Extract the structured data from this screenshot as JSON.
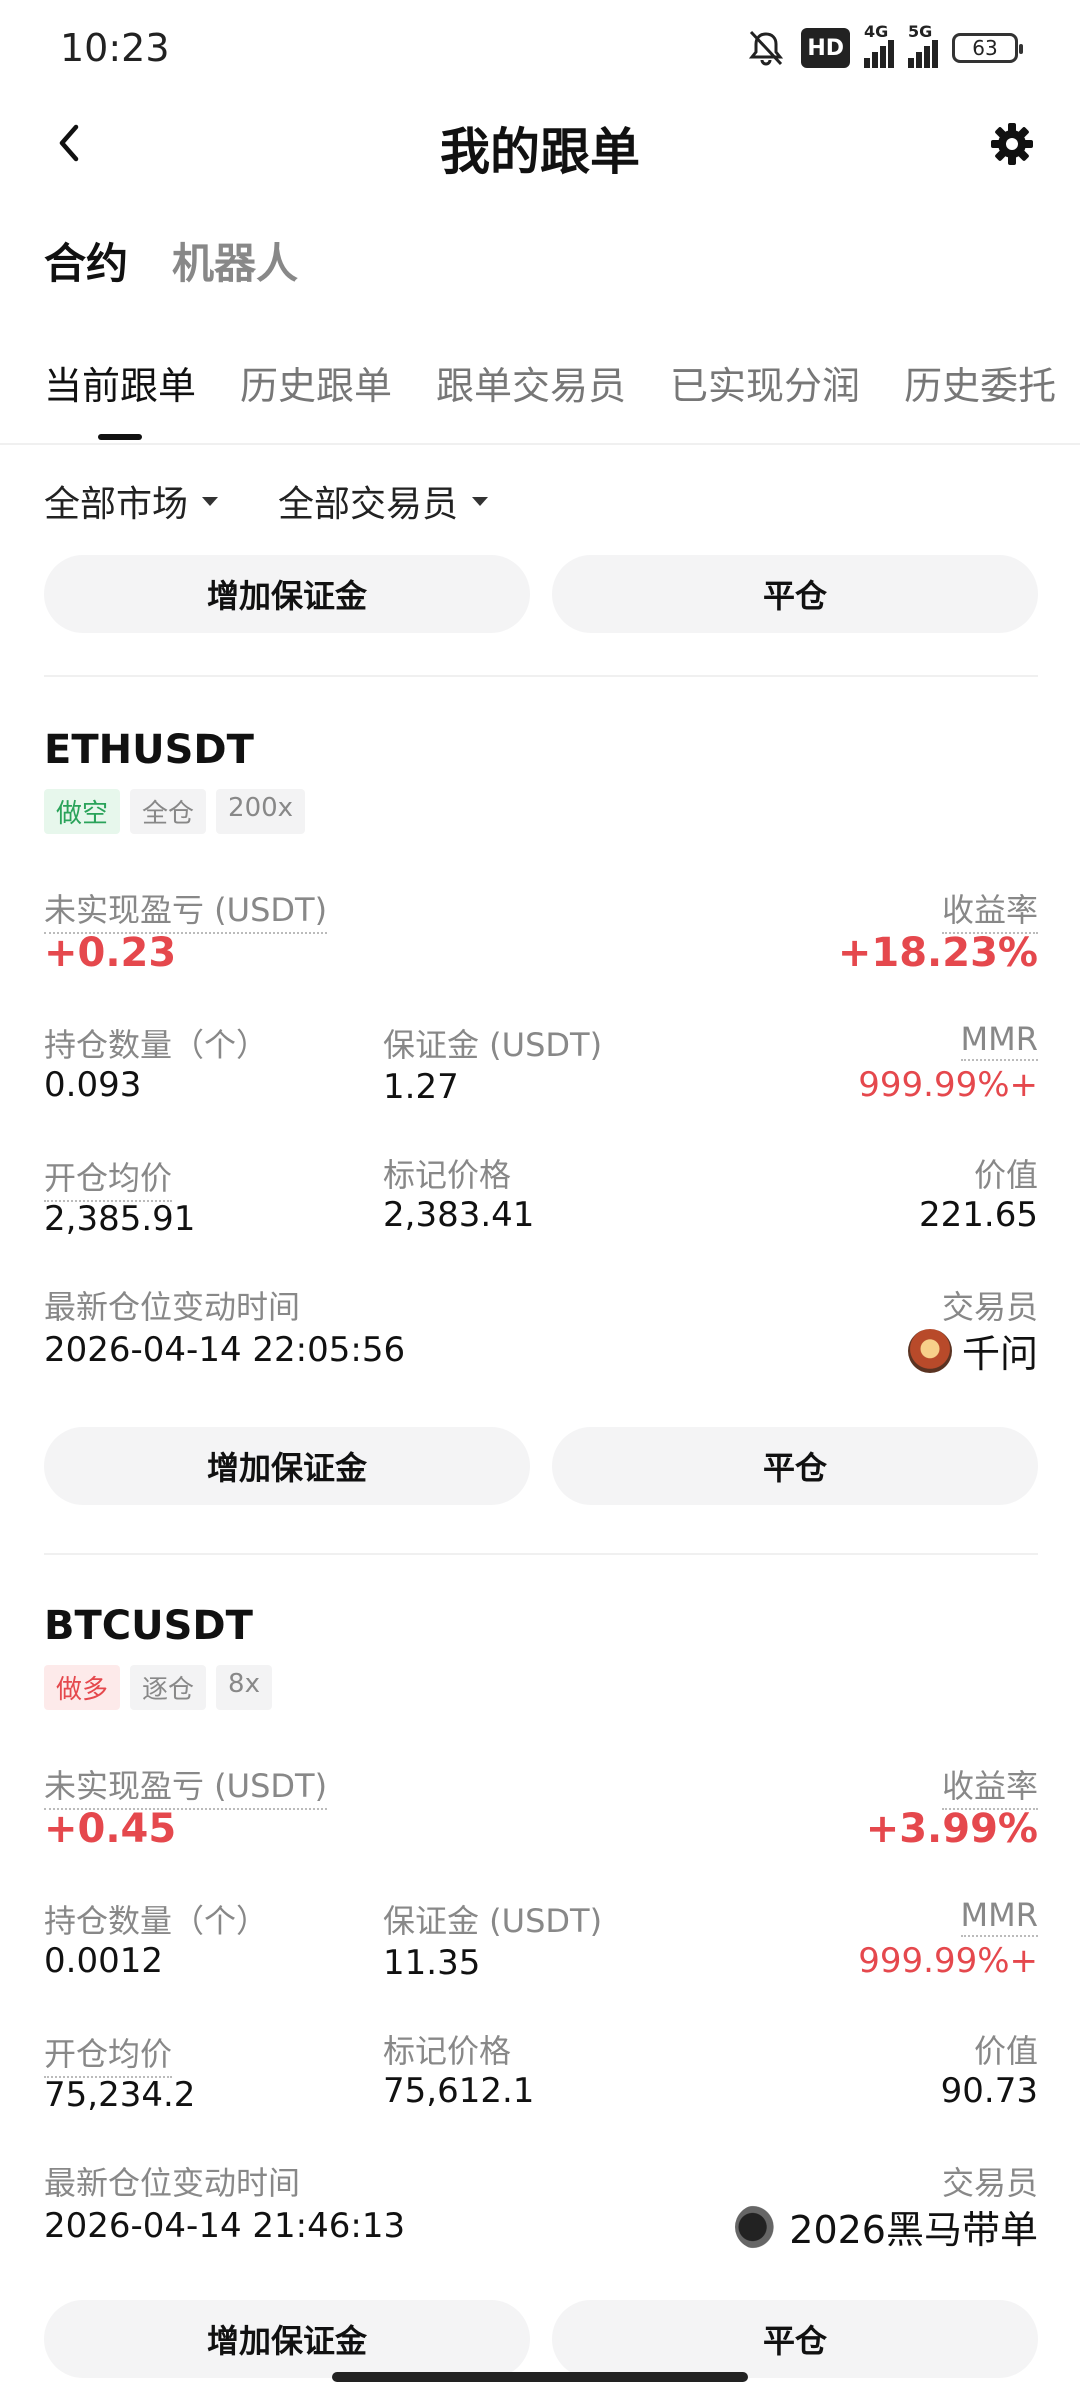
{
  "status_bar": {
    "time": "10:23",
    "hd": "HD",
    "net1": "4G",
    "net2": "5G",
    "battery": "63"
  },
  "header": {
    "title": "我的跟单"
  },
  "category_tabs": [
    "合约",
    "机器人"
  ],
  "sub_tabs": [
    "当前跟单",
    "历史跟单",
    "跟单交易员",
    "已实现分润",
    "历史委托"
  ],
  "filters": {
    "market": "全部市场",
    "trader": "全部交易员"
  },
  "buttons": {
    "add_margin": "增加保证金",
    "close": "平仓"
  },
  "labels": {
    "unrealized_pnl": "未实现盈亏 (USDT)",
    "roi": "收益率",
    "quantity": "持仓数量（个）",
    "margin": "保证金 (USDT)",
    "mmr": "MMR",
    "entry_price": "开仓均价",
    "mark_price": "标记价格",
    "value": "价值",
    "last_change_time": "最新仓位变动时间",
    "trader": "交易员"
  },
  "positions": [
    {
      "symbol": "ETHUSDT",
      "side": "做空",
      "margin_mode": "全仓",
      "leverage": "200x",
      "unrealized_pnl": "+0.23",
      "roi": "+18.23%",
      "quantity": "0.093",
      "margin": "1.27",
      "mmr": "999.99%+",
      "entry_price": "2,385.91",
      "mark_price": "2,383.41",
      "value": "221.65",
      "last_change_time": "2026-04-14 22:05:56",
      "trader": "千问"
    },
    {
      "symbol": "BTCUSDT",
      "side": "做多",
      "margin_mode": "逐仓",
      "leverage": "8x",
      "unrealized_pnl": "+0.45",
      "roi": "+3.99%",
      "quantity": "0.0012",
      "margin": "11.35",
      "mmr": "999.99%+",
      "entry_price": "75,234.2",
      "mark_price": "75,612.1",
      "value": "90.73",
      "last_change_time": "2026-04-14 21:46:13",
      "trader": "2026黑马带单"
    }
  ],
  "colors": {
    "profit": "#e5484d",
    "short_tag": "#2aa35a",
    "long_tag": "#e5484d"
  }
}
